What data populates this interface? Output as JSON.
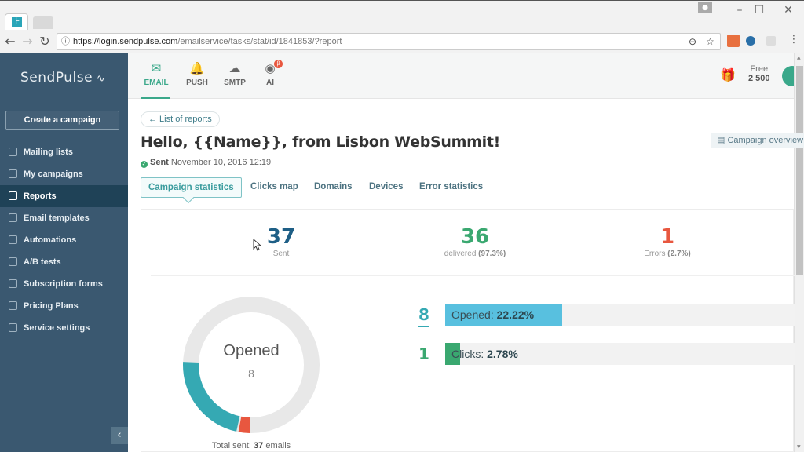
{
  "browser": {
    "url_host": "https://login.sendpulse.com",
    "url_path": "/emailservice/tasks/stat/id/1841853/?report",
    "ext_badge": "OFF"
  },
  "sidebar": {
    "logo": "SendPulse",
    "create_button": "Create a campaign",
    "items": [
      {
        "label": "Mailing lists",
        "icon": "list-icon"
      },
      {
        "label": "My campaigns",
        "icon": "upload-icon"
      },
      {
        "label": "Reports",
        "icon": "chart-icon",
        "active": true
      },
      {
        "label": "Email templates",
        "icon": "template-icon"
      },
      {
        "label": "Automations",
        "icon": "automation-icon"
      },
      {
        "label": "A/B tests",
        "icon": "ab-test-icon"
      },
      {
        "label": "Subscription forms",
        "icon": "form-icon"
      },
      {
        "label": "Pricing Plans",
        "icon": "card-icon"
      },
      {
        "label": "Service settings",
        "icon": "settings-icon"
      }
    ],
    "collapse_icon": "‹"
  },
  "topbar": {
    "products": [
      {
        "label": "EMAIL",
        "icon": "✉",
        "active": true
      },
      {
        "label": "PUSH",
        "icon": "🔔"
      },
      {
        "label": "SMTP",
        "icon": "☁"
      },
      {
        "label": "AI",
        "icon": "◉",
        "badge": "β"
      }
    ],
    "plan_label": "Free",
    "plan_value": "2 500"
  },
  "page": {
    "back_link": "← List of reports",
    "title": "Hello, {{Name}}, from Lisbon WebSummit!",
    "status": "Sent",
    "sent_date": "November 10, 2016 12:19",
    "overview_button": "Campaign overview",
    "tabs": [
      "Campaign statistics",
      "Clicks map",
      "Domains",
      "Devices",
      "Error statistics"
    ],
    "active_tab": 0
  },
  "stats": {
    "sent": {
      "value": "37",
      "label": "Sent",
      "color": "#1e5f86"
    },
    "delivered": {
      "value": "36",
      "label": "delivered",
      "pct": "(97.3%)",
      "color": "#3aa870"
    },
    "errors": {
      "value": "1",
      "label": "Errors",
      "pct": "(2.7%)",
      "color": "#e8573f"
    }
  },
  "donut": {
    "center_label": "Opened",
    "center_value": "8",
    "total_prefix": "Total sent:",
    "total_value": "37",
    "total_suffix": "emails",
    "segments": [
      {
        "name": "opened",
        "fraction": 0.2222,
        "color": "#35a9b3"
      },
      {
        "name": "errors",
        "fraction": 0.027,
        "color": "#e8573f"
      }
    ],
    "track_color": "#e8e8e8"
  },
  "metrics": [
    {
      "count": "8",
      "label": "Opened:",
      "pct_text": "22.22%",
      "fraction": 0.2222,
      "color": "#58c0df",
      "num_color": "#35a9b3"
    },
    {
      "count": "1",
      "label": "Clicks:",
      "pct_text": "2.78%",
      "fraction": 0.0278,
      "color": "#3aa870",
      "num_color": "#3aa870"
    }
  ]
}
